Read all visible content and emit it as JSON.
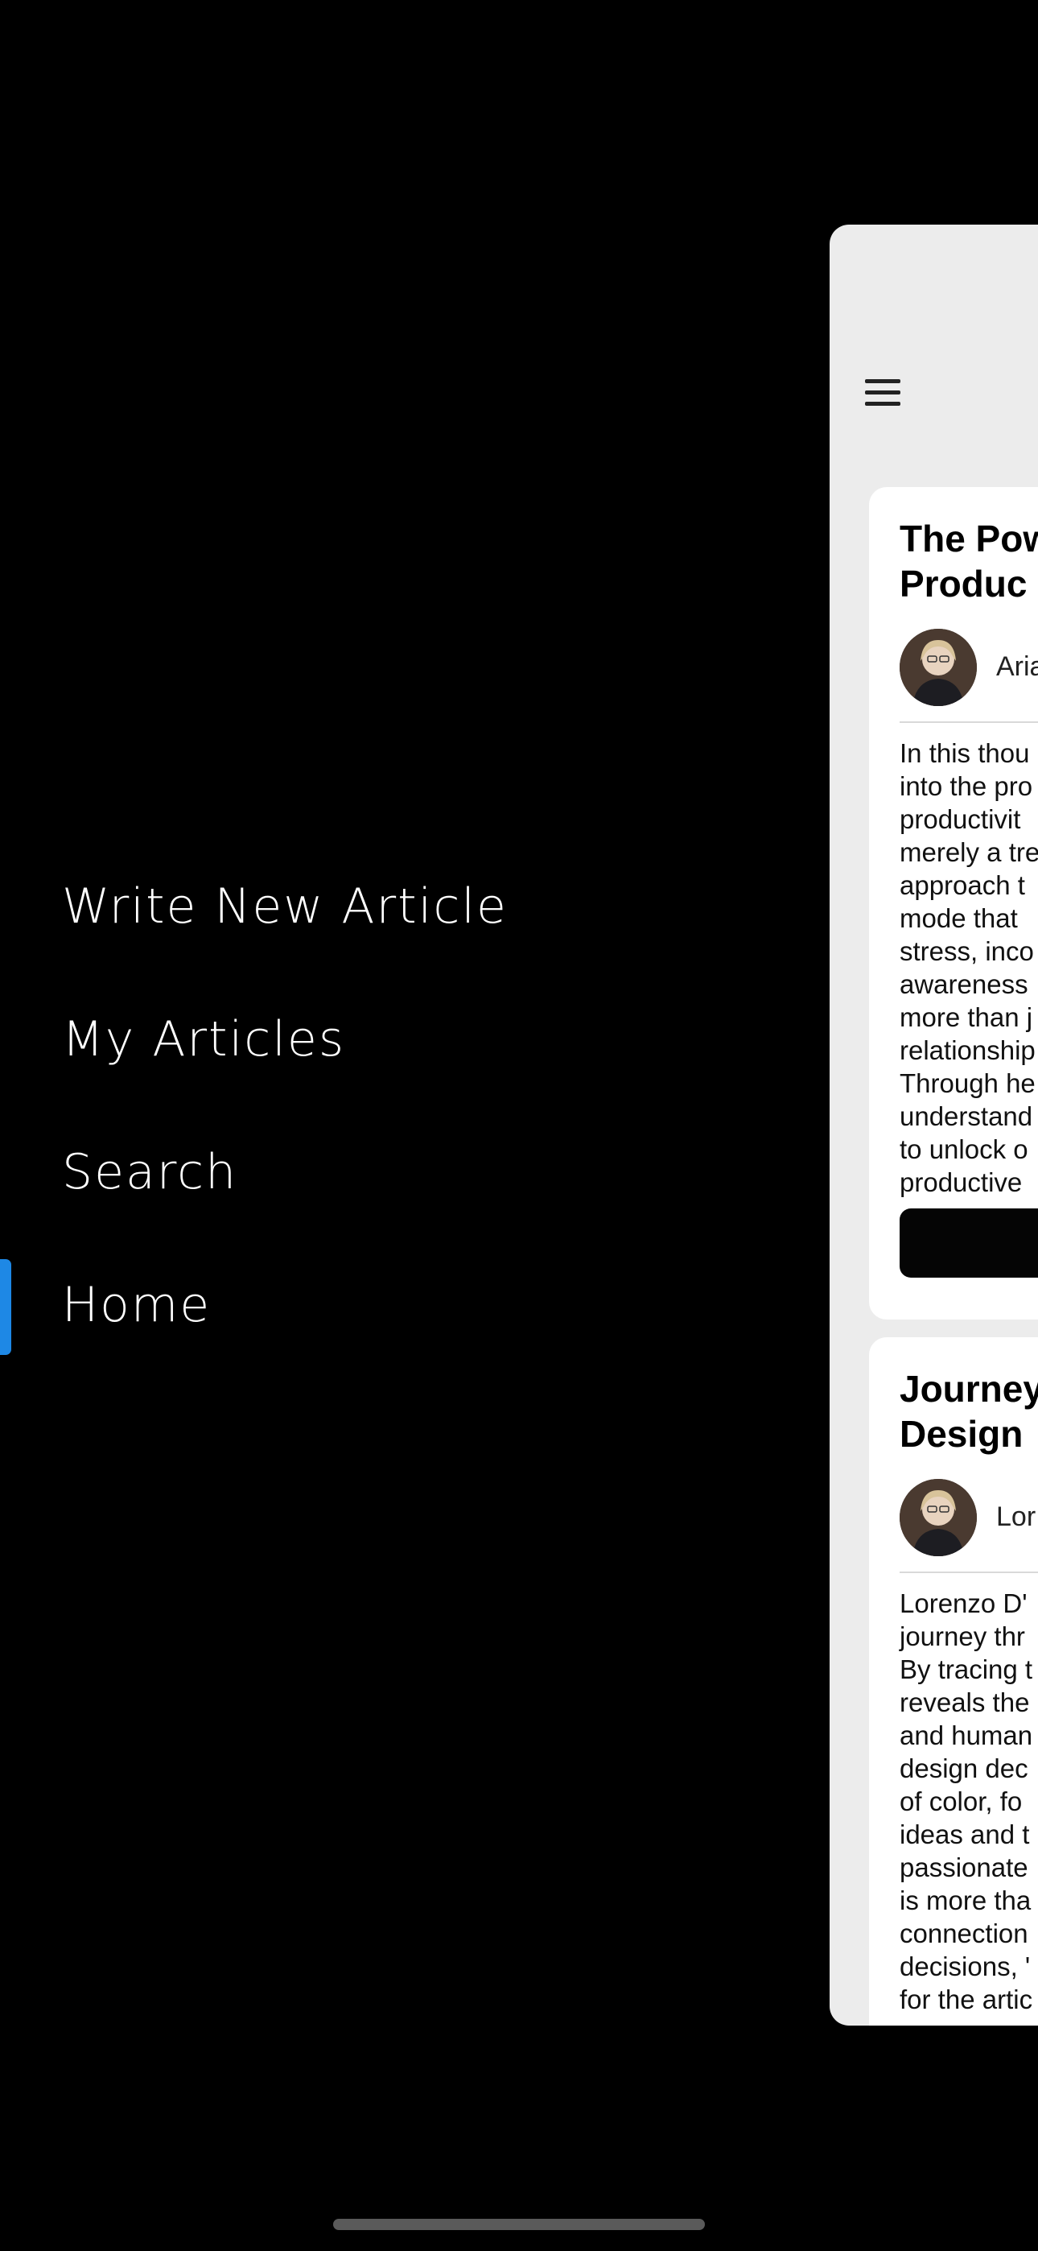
{
  "side_menu": {
    "items": [
      {
        "label": "Write New Article"
      },
      {
        "label": "My Articles"
      },
      {
        "label": "Search"
      },
      {
        "label": "Home",
        "active": true
      }
    ],
    "active_color": "#1e88e5"
  },
  "main": {
    "menu_icon": "hamburger-menu-icon",
    "articles": [
      {
        "title_lines": [
          "The Pow",
          "Produc"
        ],
        "author": "Aria",
        "excerpt_lines": [
          "In this thou",
          "into the pro",
          "productivit",
          "merely a tre",
          "approach t",
          "mode that",
          "stress, inco",
          "awareness",
          "more than j",
          "relationship",
          "Through he",
          "understand",
          "to unlock o",
          "productive"
        ]
      },
      {
        "title_lines": [
          "Journey",
          "Design"
        ],
        "author": "Lor",
        "excerpt_lines": [
          "Lorenzo D'",
          "journey thr",
          "By tracing t",
          "reveals the",
          "and human",
          "design dec",
          "of color, fo",
          "ideas and t",
          "passionate",
          "is more tha",
          "connection",
          "decisions, '",
          "for the artic"
        ]
      }
    ]
  }
}
